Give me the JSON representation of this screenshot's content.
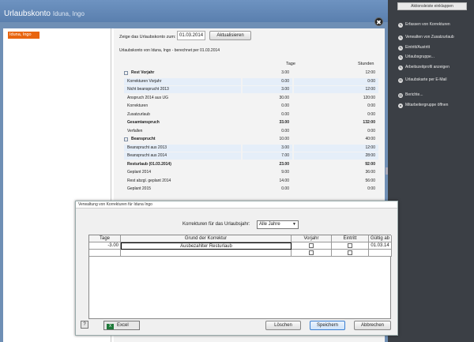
{
  "window": {
    "title": "Urlaubskonto",
    "title_name": "Iduna, Ingo",
    "close_glyph": "✖"
  },
  "employees": [
    "Iduna, Ingo"
  ],
  "report": {
    "date_label": "Zeige das Urlaubskonto zum:",
    "date_value": "01.03.2014",
    "refresh_label": "Aktualisieren",
    "subtitle": "Urlaubskonto von Iduna, Ingo - berechnet per 01.03.2014",
    "col_days": "Tage",
    "col_hours": "Stunden",
    "rows": [
      {
        "label": "Rest Vorjahr",
        "days": "3.00",
        "hours": "12:00",
        "type": "group"
      },
      {
        "label": "Korrekturen Vorjahr",
        "days": "0.00",
        "hours": "0:00",
        "type": "band"
      },
      {
        "label": "Nicht beansprucht 2013",
        "days": "3.00",
        "hours": "12:00",
        "type": "band"
      },
      {
        "label": "Anspruch 2014 aus UG",
        "days": "30.00",
        "hours": "120:00",
        "type": "plain"
      },
      {
        "label": "Korrekturen",
        "days": "0.00",
        "hours": "0:00",
        "type": "plain"
      },
      {
        "label": "Zusatzurlaub",
        "days": "0.00",
        "hours": "0:00",
        "type": "plain"
      },
      {
        "label": "Gesamtanspruch",
        "days": "33.00",
        "hours": "132:00",
        "type": "bold"
      },
      {
        "label": "Verfallen",
        "days": "0.00",
        "hours": "0:00",
        "type": "plain"
      },
      {
        "label": "Beansprucht",
        "days": "10.00",
        "hours": "40:00",
        "type": "group"
      },
      {
        "label": "Beansprucht aus 2013",
        "days": "3.00",
        "hours": "12:00",
        "type": "band"
      },
      {
        "label": "Beansprucht aus 2014",
        "days": "7.00",
        "hours": "28:00",
        "type": "band"
      },
      {
        "label": "Resturlaub (01.03.2014)",
        "days": "23.00",
        "hours": "92:00",
        "type": "bold"
      },
      {
        "label": "Geplant 2014",
        "days": "9.00",
        "hours": "36:00",
        "type": "plain"
      },
      {
        "label": "Rest abzgl. geplant 2014",
        "days": "14.00",
        "hours": "56:00",
        "type": "plain"
      },
      {
        "label": "Geplant 2015",
        "days": "0.00",
        "hours": "0:00",
        "type": "plain"
      }
    ]
  },
  "sidebar": {
    "tab_label": "Aktionsleiste einklappen",
    "items": [
      {
        "label": "Erfassen von Korrekturen",
        "icon": "pencil-icon",
        "glyph": "✎"
      },
      {
        "label": "Verwalten von Zusatzurlaub",
        "icon": "pencil-icon",
        "glyph": "✎"
      },
      {
        "label": "Eintritt/Austritt",
        "icon": "pencil-icon",
        "glyph": "✎"
      },
      {
        "label": "Urlaubsgruppe...",
        "icon": "pencil-icon",
        "glyph": "✎"
      },
      {
        "label": "Arbeitszeitprofil anzeigen",
        "icon": "pencil-icon",
        "glyph": "✎"
      },
      {
        "label": "Urlaubskarte per E-Mail",
        "icon": "mail-icon",
        "glyph": "✉"
      },
      {
        "label": "Berichte...",
        "icon": "report-icon",
        "glyph": "▤"
      },
      {
        "label": "Mitarbeitergruppe öffnen",
        "icon": "group-icon",
        "glyph": "●"
      }
    ]
  },
  "dialog": {
    "title": "Verwaltung von Korrekturen für Iduna Ingo",
    "year_label": "Korrekturen für das Urlaubsjahr:",
    "year_value": "Alle Jahre",
    "columns": [
      "Tage",
      "Grund der Korrektur",
      "Vorjahr",
      "Eintritt",
      "Gültig ab"
    ],
    "rows": [
      {
        "days": "-3.00",
        "reason": "Ausbezahlter Resturlaub",
        "valid_from": "01.03.14"
      },
      {
        "days": "",
        "reason": "",
        "valid_from": ""
      }
    ],
    "help_label": "?",
    "excel_label": "Excel",
    "excel_glyph": "X",
    "delete_label": "Löschen",
    "save_label": "Speichern",
    "cancel_label": "Abbrechen"
  }
}
